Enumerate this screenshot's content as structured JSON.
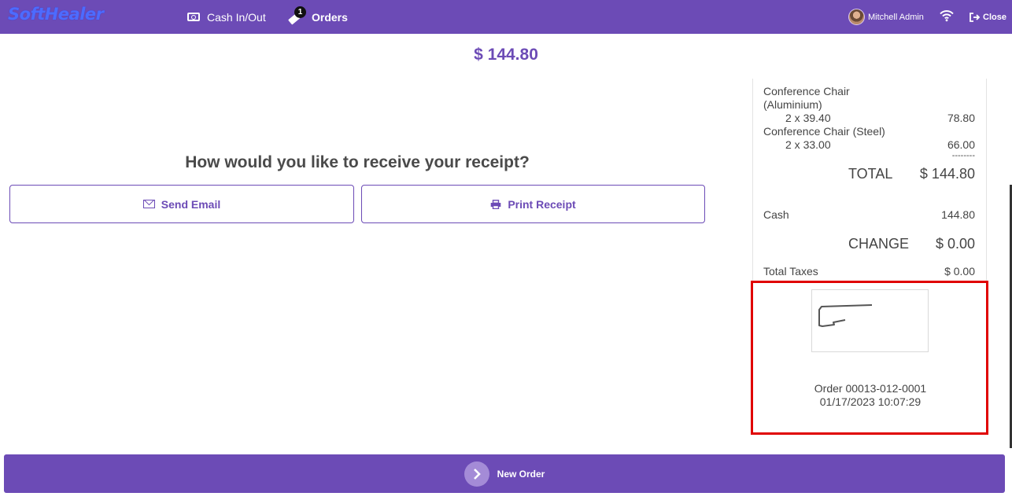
{
  "header": {
    "logo": "SoftHealer",
    "cash_label": "Cash In/Out",
    "orders_label": "Orders",
    "orders_badge": "1",
    "user_name": "Mitchell Admin",
    "close_label": "Close"
  },
  "payment": {
    "total_amount": "$ 144.80",
    "question": "How would you like to receive your receipt?",
    "send_email_label": "Send Email",
    "print_receipt_label": "Print Receipt"
  },
  "receipt": {
    "items": [
      {
        "name_line1": "Conference Chair",
        "name_line2": "(Aluminium)",
        "qty_price": "2 x 39.40",
        "amount": "78.80"
      },
      {
        "name_line1": "Conference Chair (Steel)",
        "name_line2": "",
        "qty_price": "2 x 33.00",
        "amount": "66.00"
      }
    ],
    "separator": "--------",
    "total_label": "TOTAL",
    "total_value": "$ 144.80",
    "payment_method": "Cash",
    "payment_amount": "144.80",
    "change_label": "CHANGE",
    "change_value": "$ 0.00",
    "taxes_label": "Total Taxes",
    "taxes_value": "$ 0.00",
    "order_ref": "Order 00013-012-0001",
    "order_datetime": "01/17/2023 10:07:29"
  },
  "footer": {
    "new_order_label": "New Order"
  },
  "colors": {
    "brand": "#6c4bb6",
    "highlight": "#e00000"
  }
}
